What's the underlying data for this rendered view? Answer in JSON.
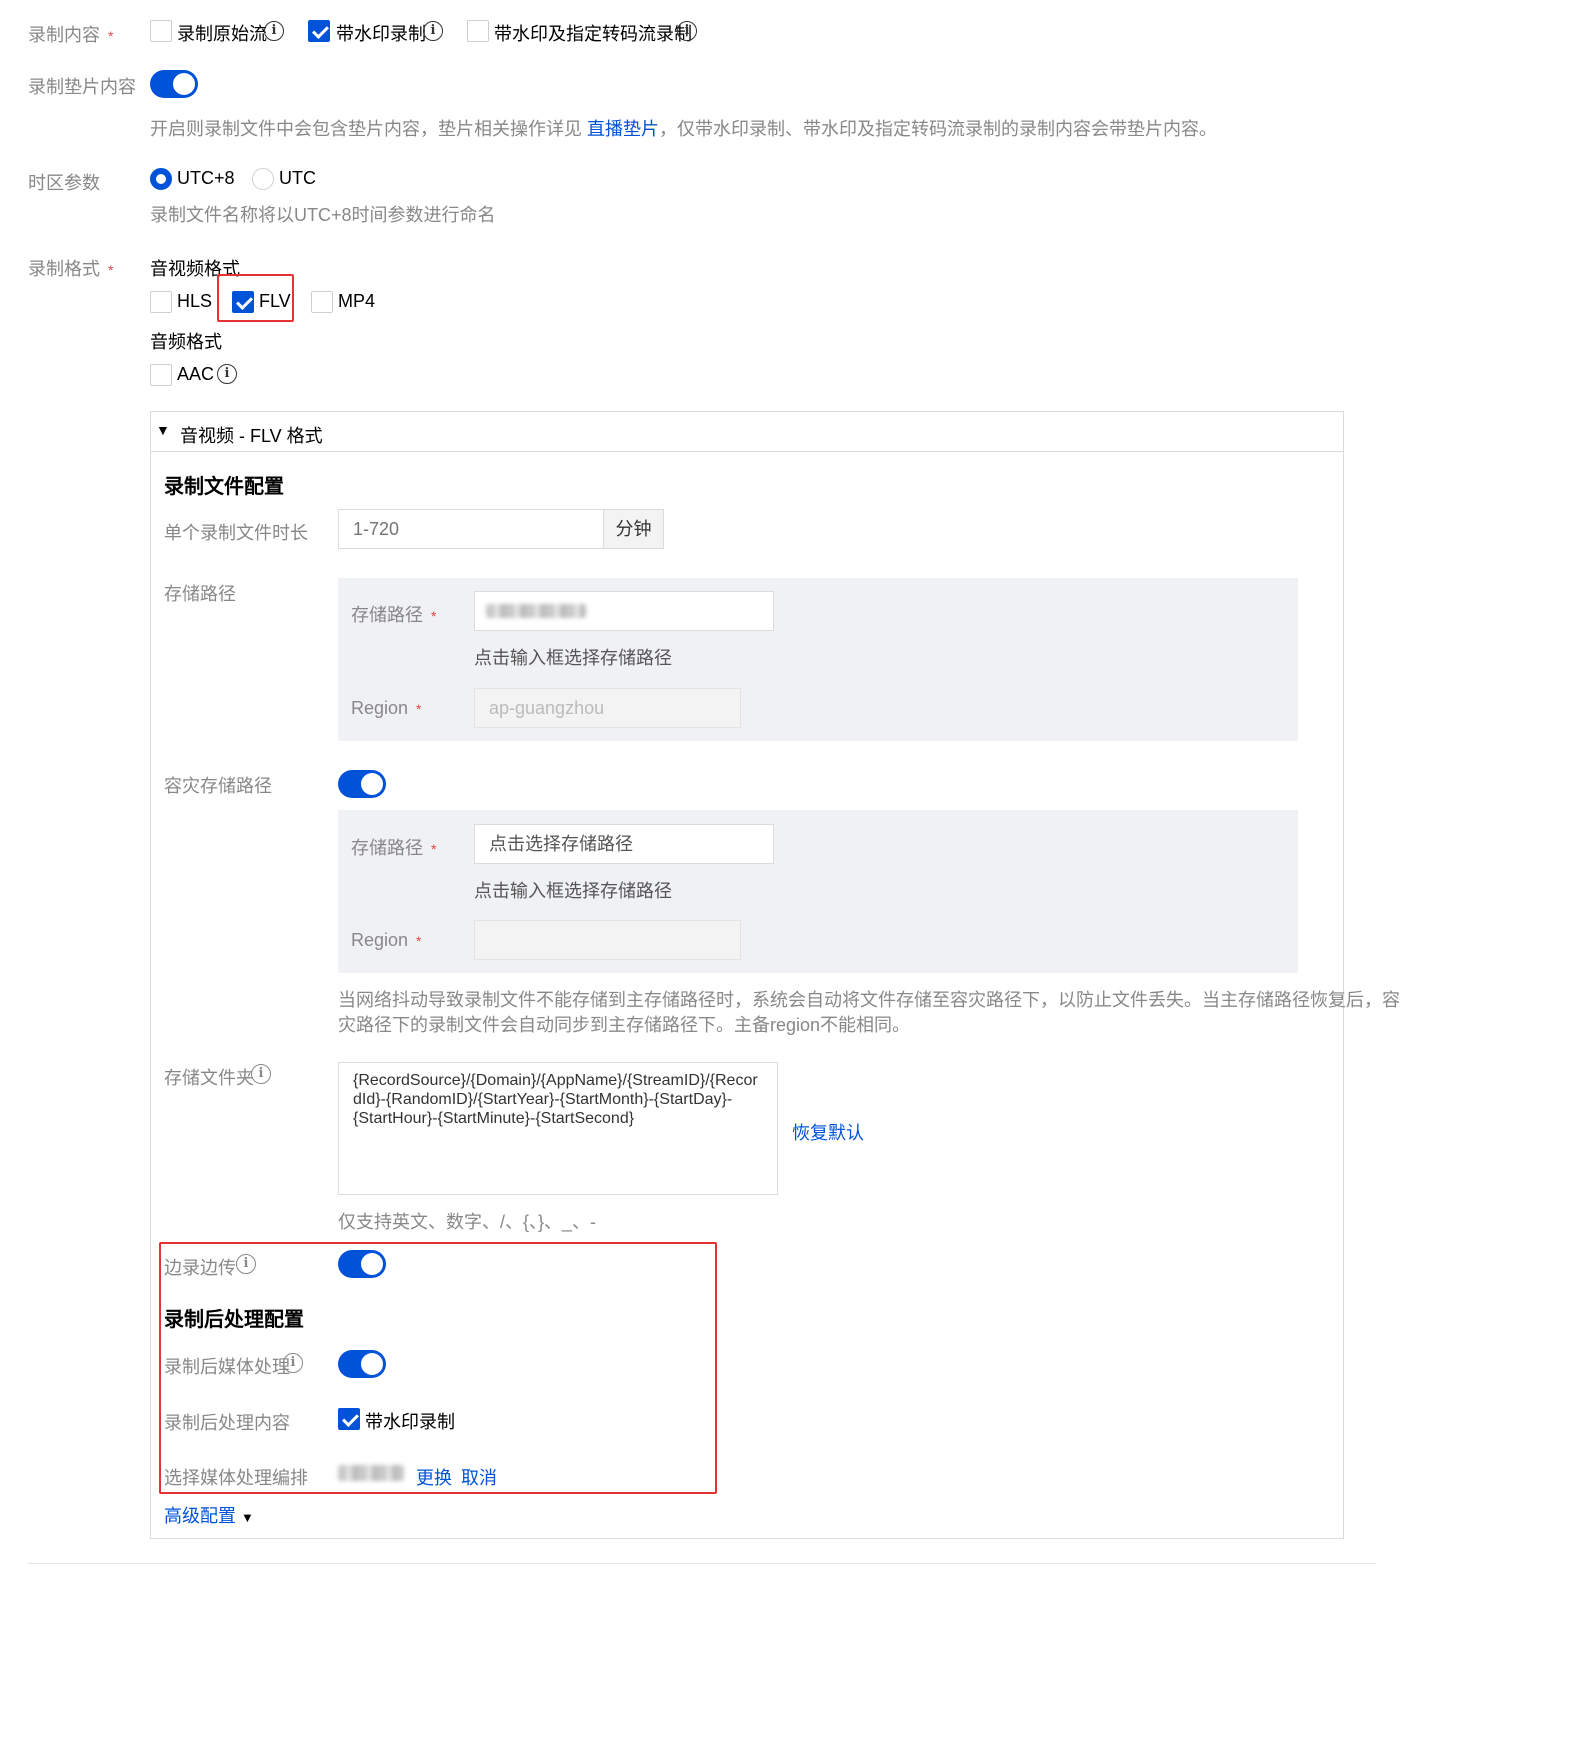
{
  "record_content": {
    "label": "录制内容",
    "options": [
      "录制原始流",
      "带水印录制",
      "带水印及指定转码流录制"
    ],
    "checked": [
      false,
      true,
      false
    ]
  },
  "record_slate": {
    "label": "录制垫片内容",
    "enabled": true,
    "hint_prefix": "开启则录制文件中会包含垫片内容，垫片相关操作详见",
    "hint_link": "直播垫片",
    "hint_suffix": "，仅带水印录制、带水印及指定转码流录制的录制内容会带垫片内容。"
  },
  "timezone": {
    "label": "时区参数",
    "options": [
      "UTC+8",
      "UTC"
    ],
    "selected": "UTC+8",
    "hint": "录制文件名称将以UTC+8时间参数进行命名"
  },
  "record_format": {
    "label": "录制格式",
    "av_heading": "音视频格式",
    "av_options": [
      "HLS",
      "FLV",
      "MP4"
    ],
    "av_checked": [
      false,
      true,
      false
    ],
    "audio_heading": "音频格式",
    "audio_options": [
      "AAC"
    ],
    "audio_checked": [
      false
    ]
  },
  "flv_panel": {
    "header": "音视频 - FLV 格式",
    "file_config_title": "录制文件配置",
    "duration_label": "单个录制文件时长",
    "duration_placeholder": "1-720",
    "duration_unit": "分钟",
    "storage_path_label": "存储路径",
    "storage": {
      "path_label": "存储路径",
      "path_hint": "点击输入框选择存储路径",
      "region_label": "Region",
      "region_value": "ap-guangzhou"
    },
    "dr_label": "容灾存储路径",
    "dr_enabled": true,
    "dr_storage": {
      "path_label": "存储路径",
      "path_placeholder": "点击选择存储路径",
      "path_hint": "点击输入框选择存储路径",
      "region_label": "Region",
      "region_value": ""
    },
    "dr_hint_line1": "当网络抖动导致录制文件不能存储到主存储路径时，系统会自动将文件存储至容灾路径下，以防止文件丢失。当主存储路径恢复后，容",
    "dr_hint_line2": "灾路径下的录制文件会自动同步到主存储路径下。主备region不能相同。",
    "folder_label": "存储文件夹",
    "folder_value": "{RecordSource}/{Domain}/{AppName}/{StreamID}/{RecordId}-{RandomID}/{StartYear}-{StartMonth}-{StartDay}-{StartHour}-{StartMinute}-{StartSecond}",
    "folder_lines": [
      "{RecordSource}/{Domain}/{AppName}/{StreamID}/{Recor",
      "dId}-{RandomID}/{StartYear}-{StartMonth}-{StartDay}-",
      "{StartHour}-{StartMinute}-{StartSecond}"
    ],
    "restore_default": "恢复默认",
    "folder_hint": "仅支持英文、数字、/、{、}、_、-",
    "upload_while_recording_label": "边录边传",
    "upload_while_recording_enabled": true,
    "post_title": "录制后处理配置",
    "post_media_label": "录制后媒体处理",
    "post_media_enabled": true,
    "post_content_label": "录制后处理内容",
    "post_content_option": "带水印录制",
    "post_content_checked": true,
    "orchestration_label": "选择媒体处理编排",
    "change_link": "更换",
    "cancel_link": "取消",
    "advanced": "高级配置"
  },
  "colors": {
    "primary": "#0052d9",
    "label_grey": "#888888",
    "required_red": "#e54545",
    "highlight_red": "#e63232",
    "panel_grey": "#f0f1f4"
  }
}
